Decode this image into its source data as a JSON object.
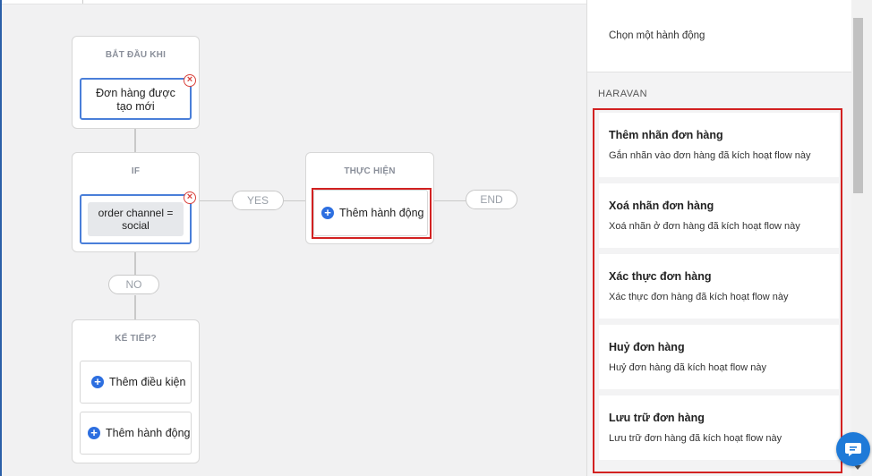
{
  "flow": {
    "start": {
      "title": "BẮT ĐẦU KHI",
      "trigger": "Đơn hàng được tạo mới"
    },
    "if": {
      "title": "IF",
      "condition": "order channel = social"
    },
    "yes_label": "YES",
    "no_label": "NO",
    "end_label": "END",
    "do": {
      "title": "THỰC HIỆN",
      "add_action": "Thêm hành động"
    },
    "next": {
      "title": "KẾ TIẾP?",
      "add_condition": "Thêm điều kiện",
      "add_action": "Thêm hành động"
    }
  },
  "panel": {
    "header": "Chọn một hành động",
    "section": "HARAVAN",
    "actions": [
      {
        "title": "Thêm nhãn đơn hàng",
        "desc": "Gắn nhãn vào đơn hàng đã kích hoạt flow này"
      },
      {
        "title": "Xoá nhãn đơn hàng",
        "desc": "Xoá nhãn ở đơn hàng đã kích hoạt flow này"
      },
      {
        "title": "Xác thực đơn hàng",
        "desc": "Xác thực đơn hàng đã kích hoạt flow này"
      },
      {
        "title": "Huỷ đơn hàng",
        "desc": "Huỷ đơn hàng đã kích hoạt flow này"
      },
      {
        "title": "Lưu trữ đơn hàng",
        "desc": "Lưu trữ đơn hàng đã kích hoạt flow này"
      }
    ]
  },
  "colors": {
    "accent": "#2d6fe0",
    "highlight": "#d22121",
    "delete": "#d9413b"
  }
}
